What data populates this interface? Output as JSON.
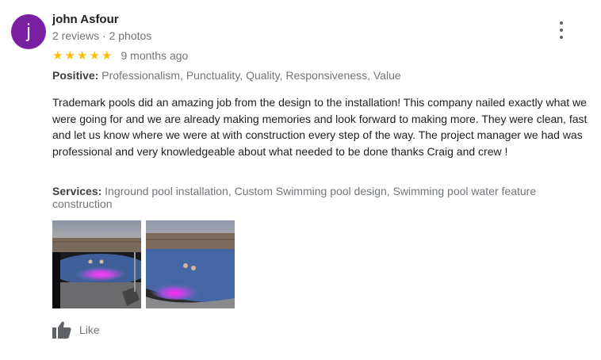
{
  "review": {
    "author": {
      "initial": "j",
      "name": "john Asfour",
      "meta": "2 reviews · 2 photos",
      "avatar_color": "#7b1fa2"
    },
    "rating": 5,
    "star_glyph": "★",
    "star_color": "#fbbc04",
    "date": "9 months ago",
    "positive": {
      "label": "Positive:",
      "value": "Professionalism, Punctuality, Quality, Responsiveness, Value"
    },
    "text": "Trademark pools did an amazing job from the design to the installation! This company nailed exactly what we were going for and we are already making memories and look forward to making more. They were clean, fast and let us know where we were at with construction every step of the way. The project manager we had was professional and very knowledgeable about what needed to be done thanks Craig and crew !",
    "services": {
      "label": "Services:",
      "value": "Inground pool installation, Custom Swimming pool design, Swimming pool water feature construction"
    },
    "photos": [
      "pool-photo-night-1",
      "pool-photo-night-2"
    ],
    "like_label": "Like",
    "icons": {
      "more": "more-vert-icon",
      "like": "thumbs-up-icon"
    }
  }
}
